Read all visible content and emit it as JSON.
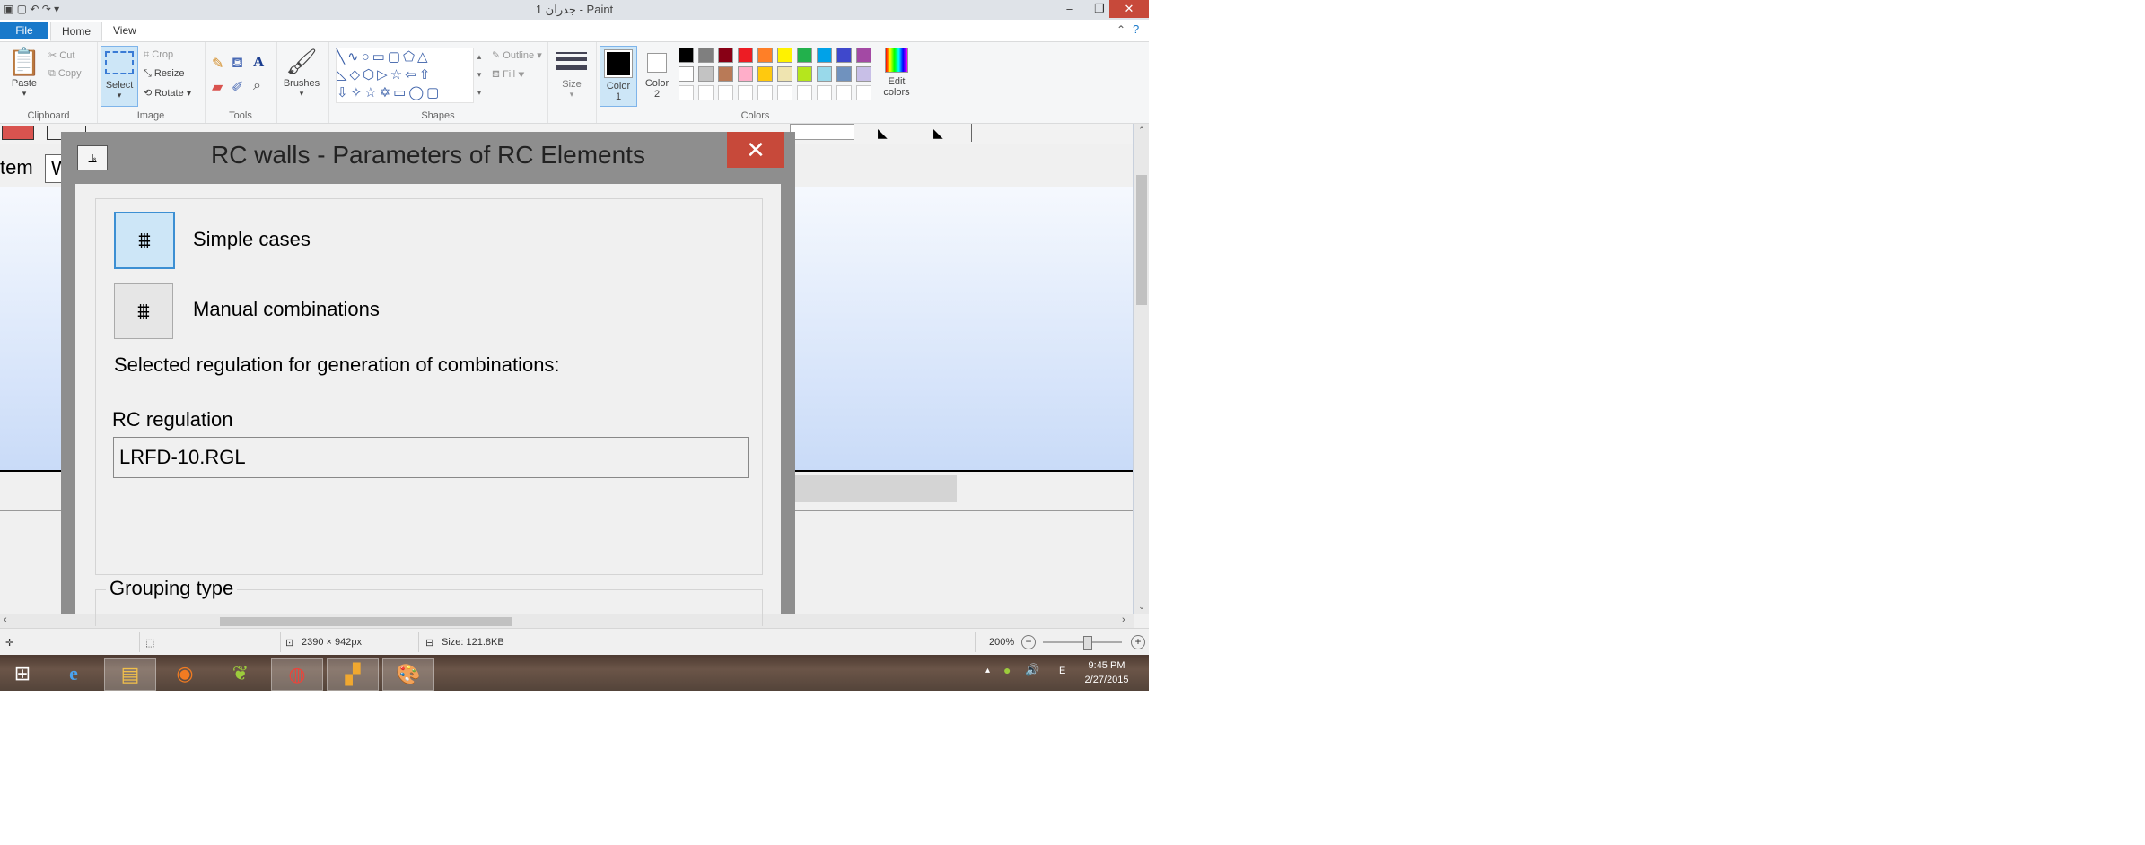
{
  "window": {
    "title": "جدران 1 - Paint",
    "minimize": "–",
    "restore": "❐",
    "close": "✕"
  },
  "tabs": {
    "file": "File",
    "home": "Home",
    "view": "View"
  },
  "ribbon": {
    "clipboard": {
      "paste": "Paste",
      "cut": "Cut",
      "copy": "Copy",
      "label": "Clipboard"
    },
    "image": {
      "select": "Select",
      "crop": "Crop",
      "resize": "Resize",
      "rotate": "Rotate",
      "label": "Image"
    },
    "tools": {
      "label": "Tools"
    },
    "brushes": {
      "label": "Brushes"
    },
    "shapes": {
      "outline": "Outline",
      "fill": "Fill",
      "label": "Shapes"
    },
    "size": {
      "label": "Size"
    },
    "colors": {
      "color1": "Color 1",
      "color2": "Color 2",
      "edit": "Edit colors",
      "label": "Colors",
      "row1": [
        "#000000",
        "#7f7f7f",
        "#880015",
        "#ed1c24",
        "#ff7f27",
        "#fff200",
        "#22b14c",
        "#00a2e8",
        "#3f48cc",
        "#a349a4"
      ],
      "row2": [
        "#ffffff",
        "#c3c3c3",
        "#b97a57",
        "#ffaec9",
        "#ffc90e",
        "#efe4b0",
        "#b5e61d",
        "#99d9ea",
        "#7092be",
        "#c8bfe7"
      ]
    }
  },
  "dialog": {
    "title": "RC walls - Parameters of RC Elements",
    "close": "✕",
    "simple_cases": "Simple cases",
    "manual_combinations": "Manual combinations",
    "selected_regulation_text": "Selected regulation for generation of combinations:",
    "rc_regulation_label": "RC regulation",
    "rc_regulation_value": "LRFD-10.RGL",
    "grouping_type_label": "Grouping type"
  },
  "background_fragments": {
    "item_tab": "tem",
    "w_tab": "W"
  },
  "statusbar": {
    "dimensions": "2390 × 942px",
    "size": "Size: 121.8KB",
    "zoom": "200%"
  },
  "taskbar": {
    "language": "E",
    "time": "9:45 PM",
    "date": "2/27/2015"
  }
}
